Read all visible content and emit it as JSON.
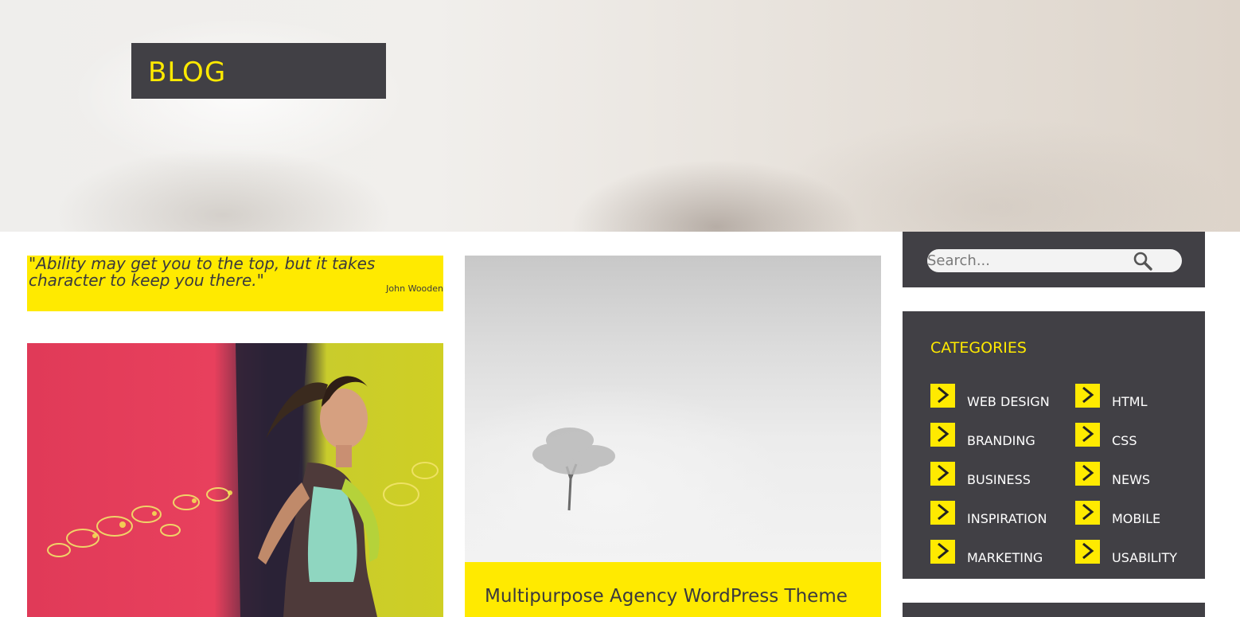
{
  "hero": {
    "title": "BLOG"
  },
  "quote": {
    "text": "\"Ability may get you to the top, but it takes character to keep you there.\"",
    "author": "John Wooden"
  },
  "posts": [
    {
      "title": "Multipurpose Agency WordPress Theme"
    }
  ],
  "sidebar": {
    "search": {
      "placeholder": "Search...",
      "icon": "search-icon"
    },
    "categories": {
      "heading": "CATEGORIES",
      "items": [
        {
          "label": "WEB DESIGN"
        },
        {
          "label": "HTML"
        },
        {
          "label": "BRANDING"
        },
        {
          "label": "CSS"
        },
        {
          "label": "BUSINESS"
        },
        {
          "label": "NEWS"
        },
        {
          "label": "INSPIRATION"
        },
        {
          "label": "MOBILE"
        },
        {
          "label": "MARKETING"
        },
        {
          "label": "USABILITY"
        }
      ]
    }
  },
  "colors": {
    "accent": "#ffea00",
    "panel": "#414045",
    "text_dark": "#3b3a3d"
  }
}
